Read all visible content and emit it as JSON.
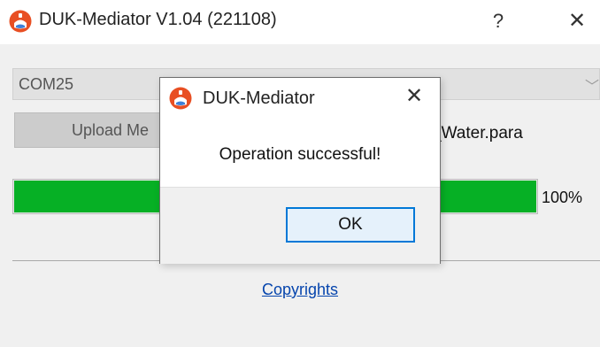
{
  "window": {
    "title": "DUK-Mediator V1.04 (221108)",
    "help_glyph": "?",
    "close_glyph": "✕"
  },
  "port": {
    "selected": "COM25",
    "arrow_glyph": "﹀"
  },
  "upload_button": {
    "label_visible": "Upload Me"
  },
  "file": {
    "name_visible": "_Water.para"
  },
  "progress": {
    "value": 100,
    "label": "100%",
    "color": "#06b025"
  },
  "footer": {
    "link": "Copyrights"
  },
  "dialog": {
    "title": "DUK-Mediator",
    "close_glyph": "✕",
    "message": "Operation successful!",
    "ok_label": "OK"
  },
  "icons": {
    "app": "duk-mediator-app-icon"
  }
}
